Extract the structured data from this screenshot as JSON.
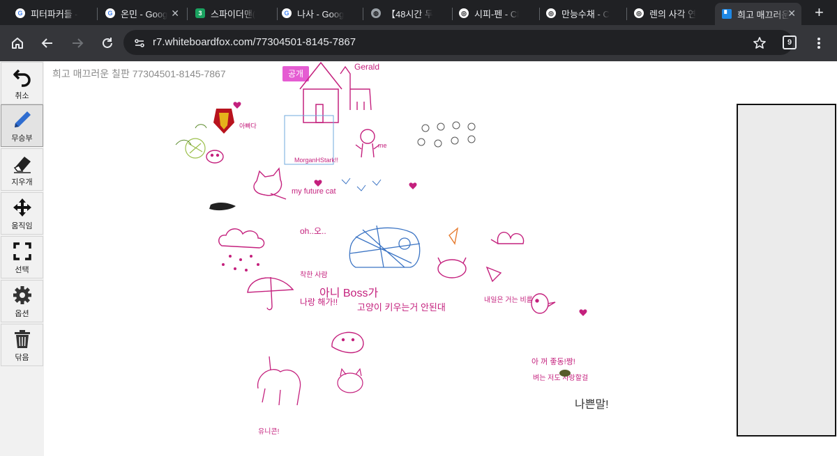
{
  "browser": {
    "tabs": [
      {
        "label": "피터파커들 -",
        "icon": "google-icon"
      },
      {
        "label": "온민 - Goog",
        "icon": "google-icon"
      },
      {
        "label": "스파이더맨(",
        "icon": "site-icon"
      },
      {
        "label": "나사 - Goog",
        "icon": "google-icon"
      },
      {
        "label": "【48시간 두",
        "icon": "globe-icon"
      },
      {
        "label": "시피-펜 - Cl",
        "icon": "chatgpt-icon"
      },
      {
        "label": "만능수채 - C",
        "icon": "chatgpt-icon"
      },
      {
        "label": "렌의 사각 연",
        "icon": "chatgpt-icon"
      },
      {
        "label": "희고 매끄러운",
        "icon": "whiteboard-icon",
        "active": true
      }
    ],
    "address": "r7.whiteboardfox.com/77304501-8145-7867",
    "tab_count": "9"
  },
  "tools": [
    {
      "label": "취소",
      "icon": "undo-icon"
    },
    {
      "label": "무승부",
      "icon": "pen-icon",
      "active": true
    },
    {
      "label": "지우개",
      "icon": "eraser-icon"
    },
    {
      "label": "움직임",
      "icon": "move-icon"
    },
    {
      "label": "선택",
      "icon": "select-icon"
    },
    {
      "label": "옵션",
      "icon": "gear-icon"
    },
    {
      "label": "닦음",
      "icon": "trash-icon"
    }
  ],
  "board": {
    "title": "희고 매끄러운 칠판 77304501-8145-7867",
    "public_label": "공개"
  },
  "drawings": {
    "texts": [
      "Gerald",
      "me",
      "아빠다",
      "MorganHStark!!",
      "my future cat",
      "oh..오..",
      "아니 Boss가",
      "고양이 키우는거 안된대",
      "나쁜말!",
      "유니콘!",
      "아 꺼 좋동!짱!",
      "벼는 저도 사랑할걸",
      "착한 사람",
      "나랑 해가!!",
      "내일은 거는 비를"
    ],
    "colors": {
      "magenta": "#c4207d",
      "blue": "#3b74c4",
      "green": "#5a8a2a",
      "pink": "#e64fa8"
    }
  }
}
